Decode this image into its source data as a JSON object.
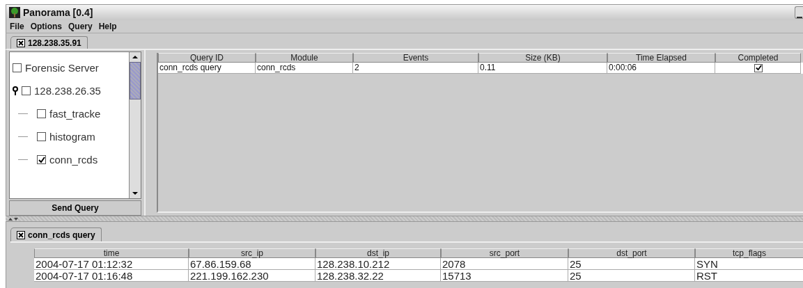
{
  "window": {
    "title": "Panorama [0.4]"
  },
  "menu": [
    "File",
    "Options",
    "Query",
    "Help"
  ],
  "server_tab": {
    "label": "128.238.35.91"
  },
  "tree": [
    {
      "label": "Forensic Server",
      "checked": false,
      "children": [
        {
          "label": "128.238.26.35",
          "checked": false,
          "children": [
            {
              "label": "fast_tracke",
              "checked": false
            },
            {
              "label": "histogram",
              "checked": false
            },
            {
              "label": "conn_rcds",
              "checked": true
            }
          ]
        }
      ]
    }
  ],
  "send_button": "Send Query",
  "queries": {
    "columns": [
      "Query ID",
      "Module",
      "Events",
      "Size (KB)",
      "Time Elapsed",
      "Completed"
    ],
    "rows": [
      {
        "query_id": "conn_rcds query",
        "module": "conn_rcds",
        "events": "2",
        "size": "0.11",
        "time_elapsed": "0:00:06",
        "completed": true
      }
    ]
  },
  "result_tab": {
    "label": "conn_rcds query"
  },
  "results": {
    "columns": [
      "time",
      "src_ip",
      "dst_ip",
      "src_port",
      "dst_port",
      "tcp_flags"
    ],
    "rows": [
      [
        "2004-07-17 01:12:32",
        "67.86.159.68",
        "128.238.10.212",
        "2078",
        "25",
        "SYN"
      ],
      [
        "2004-07-17 01:16:48",
        "221.199.162.230",
        "128.238.32.22",
        "15713",
        "25",
        "RST"
      ]
    ]
  }
}
